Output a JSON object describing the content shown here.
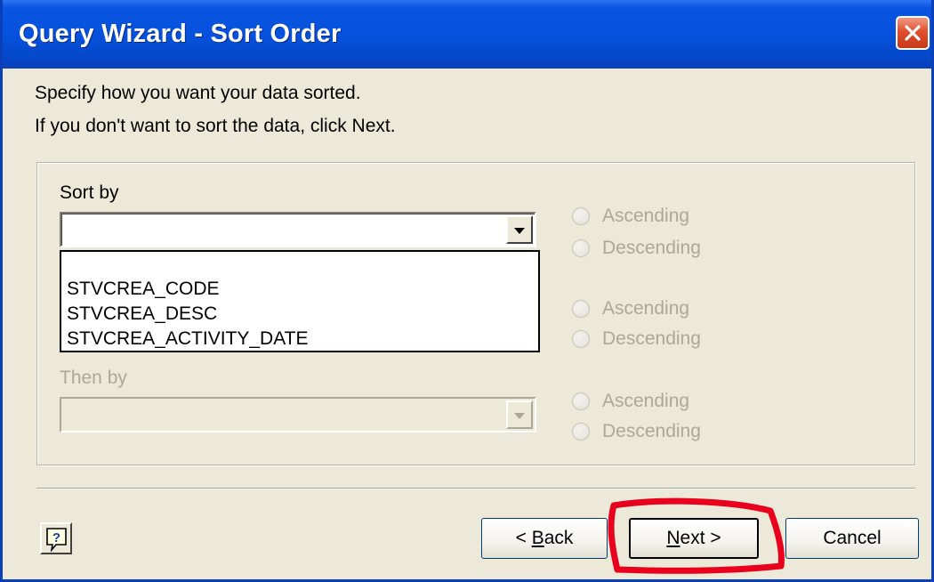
{
  "window": {
    "title": "Query Wizard - Sort Order"
  },
  "instructions": {
    "line1": "Specify how you want your data sorted.",
    "line2": "If you don't want to sort the data, click Next."
  },
  "sort_by": {
    "label": "Sort by",
    "selected_value": "",
    "options": [
      "STVCREA_CODE",
      "STVCREA_DESC",
      "STVCREA_ACTIVITY_DATE"
    ]
  },
  "then_by": {
    "label": "Then by",
    "selected_value": ""
  },
  "radios": {
    "ascending": "Ascending",
    "descending": "Descending"
  },
  "buttons": {
    "back_underline": "B",
    "back_rest": "ack",
    "back_prefix": "< ",
    "next_underline": "N",
    "next_rest": "ext >",
    "cancel": "Cancel"
  },
  "icons": {
    "close": "close-icon",
    "help": "help-icon",
    "dropdown": "chevron-down-icon"
  },
  "colors": {
    "titlebar": "#0652dd",
    "close_button": "#e04e2c",
    "dialog_background": "#ece9d8",
    "disabled_text": "#aca899",
    "annotation_red": "#e8001c"
  }
}
